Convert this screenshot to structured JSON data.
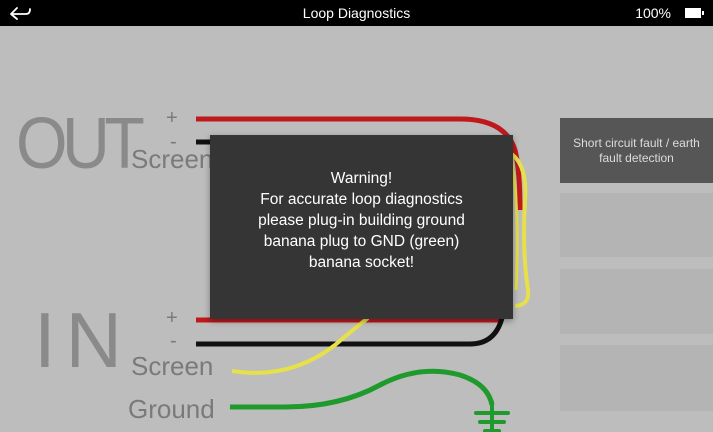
{
  "status_bar": {
    "title": "Loop Diagnostics",
    "battery_level": "100%",
    "back_icon": "back-arrow-icon",
    "battery_icon": "battery-full-icon"
  },
  "diagram": {
    "out_label": "OUT",
    "in_label": "IN",
    "out_plus": "+",
    "out_minus": "-",
    "out_screen": "Screen",
    "in_plus": "+",
    "in_minus": "-",
    "in_screen": "Screen",
    "ground": "Ground",
    "wire_colors": {
      "plus": "#c0191c",
      "minus": "#111111",
      "screen": "#e6e04a",
      "ground": "#1f9a2c"
    },
    "ground_icon": "ground-symbol-icon"
  },
  "side_panel": {
    "short_circuit_button": "Short circuit fault / earth fault detection"
  },
  "dialog": {
    "lines": [
      "Warning!",
      "For accurate loop diagnostics",
      "please plug-in building ground",
      "banana plug to GND (green)",
      "banana socket!"
    ]
  }
}
